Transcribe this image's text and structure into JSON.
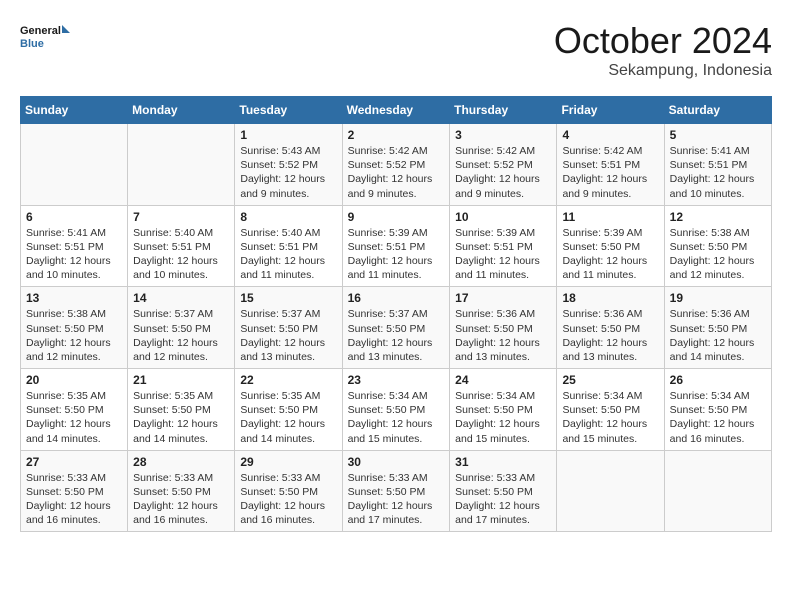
{
  "logo": {
    "line1": "General",
    "line2": "Blue"
  },
  "title": "October 2024",
  "location": "Sekampung, Indonesia",
  "days_of_week": [
    "Sunday",
    "Monday",
    "Tuesday",
    "Wednesday",
    "Thursday",
    "Friday",
    "Saturday"
  ],
  "weeks": [
    [
      {
        "day": "",
        "info": ""
      },
      {
        "day": "",
        "info": ""
      },
      {
        "day": "1",
        "info": "Sunrise: 5:43 AM\nSunset: 5:52 PM\nDaylight: 12 hours and 9 minutes."
      },
      {
        "day": "2",
        "info": "Sunrise: 5:42 AM\nSunset: 5:52 PM\nDaylight: 12 hours and 9 minutes."
      },
      {
        "day": "3",
        "info": "Sunrise: 5:42 AM\nSunset: 5:52 PM\nDaylight: 12 hours and 9 minutes."
      },
      {
        "day": "4",
        "info": "Sunrise: 5:42 AM\nSunset: 5:51 PM\nDaylight: 12 hours and 9 minutes."
      },
      {
        "day": "5",
        "info": "Sunrise: 5:41 AM\nSunset: 5:51 PM\nDaylight: 12 hours and 10 minutes."
      }
    ],
    [
      {
        "day": "6",
        "info": "Sunrise: 5:41 AM\nSunset: 5:51 PM\nDaylight: 12 hours and 10 minutes."
      },
      {
        "day": "7",
        "info": "Sunrise: 5:40 AM\nSunset: 5:51 PM\nDaylight: 12 hours and 10 minutes."
      },
      {
        "day": "8",
        "info": "Sunrise: 5:40 AM\nSunset: 5:51 PM\nDaylight: 12 hours and 11 minutes."
      },
      {
        "day": "9",
        "info": "Sunrise: 5:39 AM\nSunset: 5:51 PM\nDaylight: 12 hours and 11 minutes."
      },
      {
        "day": "10",
        "info": "Sunrise: 5:39 AM\nSunset: 5:51 PM\nDaylight: 12 hours and 11 minutes."
      },
      {
        "day": "11",
        "info": "Sunrise: 5:39 AM\nSunset: 5:50 PM\nDaylight: 12 hours and 11 minutes."
      },
      {
        "day": "12",
        "info": "Sunrise: 5:38 AM\nSunset: 5:50 PM\nDaylight: 12 hours and 12 minutes."
      }
    ],
    [
      {
        "day": "13",
        "info": "Sunrise: 5:38 AM\nSunset: 5:50 PM\nDaylight: 12 hours and 12 minutes."
      },
      {
        "day": "14",
        "info": "Sunrise: 5:37 AM\nSunset: 5:50 PM\nDaylight: 12 hours and 12 minutes."
      },
      {
        "day": "15",
        "info": "Sunrise: 5:37 AM\nSunset: 5:50 PM\nDaylight: 12 hours and 13 minutes."
      },
      {
        "day": "16",
        "info": "Sunrise: 5:37 AM\nSunset: 5:50 PM\nDaylight: 12 hours and 13 minutes."
      },
      {
        "day": "17",
        "info": "Sunrise: 5:36 AM\nSunset: 5:50 PM\nDaylight: 12 hours and 13 minutes."
      },
      {
        "day": "18",
        "info": "Sunrise: 5:36 AM\nSunset: 5:50 PM\nDaylight: 12 hours and 13 minutes."
      },
      {
        "day": "19",
        "info": "Sunrise: 5:36 AM\nSunset: 5:50 PM\nDaylight: 12 hours and 14 minutes."
      }
    ],
    [
      {
        "day": "20",
        "info": "Sunrise: 5:35 AM\nSunset: 5:50 PM\nDaylight: 12 hours and 14 minutes."
      },
      {
        "day": "21",
        "info": "Sunrise: 5:35 AM\nSunset: 5:50 PM\nDaylight: 12 hours and 14 minutes."
      },
      {
        "day": "22",
        "info": "Sunrise: 5:35 AM\nSunset: 5:50 PM\nDaylight: 12 hours and 14 minutes."
      },
      {
        "day": "23",
        "info": "Sunrise: 5:34 AM\nSunset: 5:50 PM\nDaylight: 12 hours and 15 minutes."
      },
      {
        "day": "24",
        "info": "Sunrise: 5:34 AM\nSunset: 5:50 PM\nDaylight: 12 hours and 15 minutes."
      },
      {
        "day": "25",
        "info": "Sunrise: 5:34 AM\nSunset: 5:50 PM\nDaylight: 12 hours and 15 minutes."
      },
      {
        "day": "26",
        "info": "Sunrise: 5:34 AM\nSunset: 5:50 PM\nDaylight: 12 hours and 16 minutes."
      }
    ],
    [
      {
        "day": "27",
        "info": "Sunrise: 5:33 AM\nSunset: 5:50 PM\nDaylight: 12 hours and 16 minutes."
      },
      {
        "day": "28",
        "info": "Sunrise: 5:33 AM\nSunset: 5:50 PM\nDaylight: 12 hours and 16 minutes."
      },
      {
        "day": "29",
        "info": "Sunrise: 5:33 AM\nSunset: 5:50 PM\nDaylight: 12 hours and 16 minutes."
      },
      {
        "day": "30",
        "info": "Sunrise: 5:33 AM\nSunset: 5:50 PM\nDaylight: 12 hours and 17 minutes."
      },
      {
        "day": "31",
        "info": "Sunrise: 5:33 AM\nSunset: 5:50 PM\nDaylight: 12 hours and 17 minutes."
      },
      {
        "day": "",
        "info": ""
      },
      {
        "day": "",
        "info": ""
      }
    ]
  ]
}
